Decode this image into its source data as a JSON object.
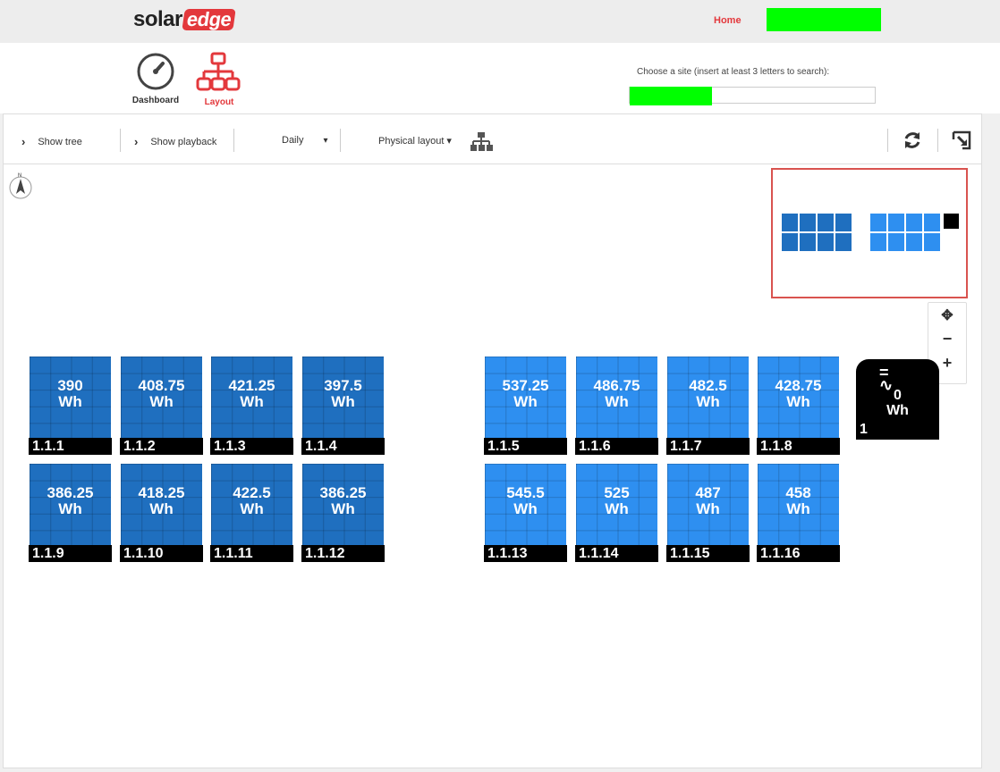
{
  "header": {
    "logo_left": "solar",
    "logo_right": "edge",
    "home_label": "Home"
  },
  "nav": {
    "dashboard_label": "Dashboard",
    "layout_label": "Layout"
  },
  "site_search": {
    "label": "Choose a site (insert at least 3 letters to search):",
    "value": ""
  },
  "toolbar": {
    "show_tree": "Show tree",
    "show_playback": "Show playback",
    "period": "Daily",
    "period_arrow": "▾",
    "layout_mode": "Physical layout ▾"
  },
  "compass_label": "N",
  "zoom": {
    "pan": "✥",
    "minus": "−",
    "plus": "+"
  },
  "colors": {
    "brand": "#e3383c",
    "panel_dark": "#1f6fbf",
    "panel_light": "#2e8ff0"
  },
  "panels": [
    {
      "id": "1.1.1",
      "value": "390",
      "unit": "Wh"
    },
    {
      "id": "1.1.2",
      "value": "408.75",
      "unit": "Wh"
    },
    {
      "id": "1.1.3",
      "value": "421.25",
      "unit": "Wh"
    },
    {
      "id": "1.1.4",
      "value": "397.5",
      "unit": "Wh"
    },
    {
      "id": "1.1.5",
      "value": "537.25",
      "unit": "Wh"
    },
    {
      "id": "1.1.6",
      "value": "486.75",
      "unit": "Wh"
    },
    {
      "id": "1.1.7",
      "value": "482.5",
      "unit": "Wh"
    },
    {
      "id": "1.1.8",
      "value": "428.75",
      "unit": "Wh"
    },
    {
      "id": "1.1.9",
      "value": "386.25",
      "unit": "Wh"
    },
    {
      "id": "1.1.10",
      "value": "418.25",
      "unit": "Wh"
    },
    {
      "id": "1.1.11",
      "value": "422.5",
      "unit": "Wh"
    },
    {
      "id": "1.1.12",
      "value": "386.25",
      "unit": "Wh"
    },
    {
      "id": "1.1.13",
      "value": "545.5",
      "unit": "Wh"
    },
    {
      "id": "1.1.14",
      "value": "525",
      "unit": "Wh"
    },
    {
      "id": "1.1.15",
      "value": "487",
      "unit": "Wh"
    },
    {
      "id": "1.1.16",
      "value": "458",
      "unit": "Wh"
    }
  ],
  "inverter": {
    "symbol": "=",
    "value": "0",
    "unit": "Wh",
    "id": "1"
  }
}
